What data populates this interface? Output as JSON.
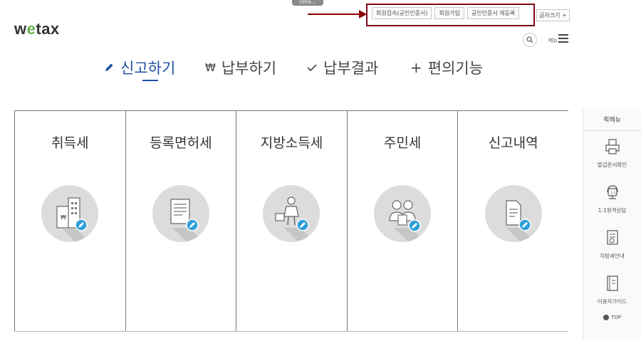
{
  "header": {
    "open_tab": "OPEN ⌄",
    "logo_prefix": "w",
    "logo_accent": "e",
    "logo_suffix": "tax",
    "top_links": [
      "회원접속(공인인증서)",
      "회원가입",
      "공인인증서 재등록"
    ],
    "font_size_label": "글자크기 +",
    "menu_label": "메뉴"
  },
  "nav": {
    "items": [
      {
        "label": "신고하기",
        "icon": "pencil-icon"
      },
      {
        "label": "납부하기",
        "icon": "won-icon"
      },
      {
        "label": "납부결과",
        "icon": "check-icon"
      },
      {
        "label": "편의기능",
        "icon": "plus-icon"
      }
    ],
    "active_index": 0
  },
  "cards": [
    {
      "title": "취득세",
      "icon": "building-icon"
    },
    {
      "title": "등록면허세",
      "icon": "document-icon"
    },
    {
      "title": "지방소득세",
      "icon": "worker-icon"
    },
    {
      "title": "주민세",
      "icon": "people-icon"
    },
    {
      "title": "신고내역",
      "icon": "file-icon"
    }
  ],
  "quick_menu": {
    "title": "퀵메뉴",
    "items": [
      {
        "label": "발급문서확인",
        "icon": "printer-icon"
      },
      {
        "label": "1:1원격상담",
        "icon": "support-icon"
      },
      {
        "label": "지방세안내",
        "icon": "guide-icon"
      },
      {
        "label": "이용자가이드",
        "icon": "book-icon"
      }
    ],
    "top_label": "TOP"
  },
  "colors": {
    "accent": "#1f4fa3",
    "logo_green": "#6ab04c",
    "highlight": "#7a0a16"
  }
}
